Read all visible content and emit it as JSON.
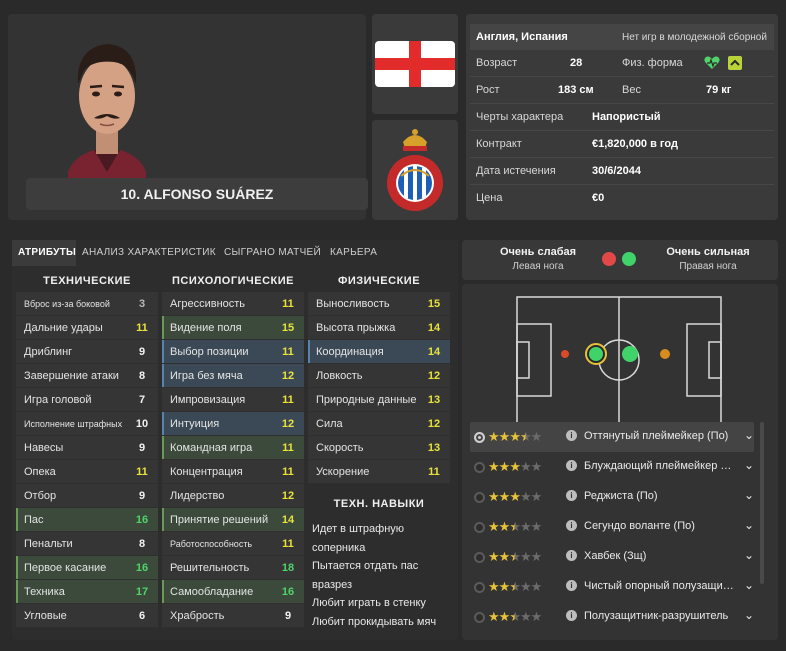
{
  "player": {
    "name": "10. ALFONSO SUÁREZ"
  },
  "info": {
    "nationality": "Англия, Испания",
    "youth_caps": "Нет игр в молодежной сборной",
    "age_label": "Возраст",
    "age": "28",
    "fitness_label": "Физ. форма",
    "height_label": "Рост",
    "height": "183 см",
    "weight_label": "Вес",
    "weight": "79 кг",
    "personality_label": "Черты характера",
    "personality": "Напористый",
    "contract_label": "Контракт",
    "contract": "€1,820,000 в год",
    "expiry_label": "Дата истечения",
    "expiry": "30/6/2044",
    "value_label": "Цена",
    "value": "€0"
  },
  "tabs": [
    "АТРИБУТЫ",
    "АНАЛИЗ ХАРАКТЕРИСТИК",
    "СЫГРАНО МАТЧЕЙ",
    "КАРЬЕРА"
  ],
  "columns": {
    "technical": "ТЕХНИЧЕСКИЕ",
    "mental": "ПСИХОЛОГИЧЕСКИЕ",
    "physical": "ФИЗИЧЕСКИЕ",
    "traits": "ТЕХН. НАВЫКИ"
  },
  "technical": [
    {
      "name": "Вброс из-за боковой",
      "value": "3"
    },
    {
      "name": "Дальние удары",
      "value": "11"
    },
    {
      "name": "Дриблинг",
      "value": "9"
    },
    {
      "name": "Завершение атаки",
      "value": "8"
    },
    {
      "name": "Игра головой",
      "value": "7"
    },
    {
      "name": "Исполнение штрафных",
      "value": "10"
    },
    {
      "name": "Навесы",
      "value": "9"
    },
    {
      "name": "Опека",
      "value": "11"
    },
    {
      "name": "Отбор",
      "value": "9"
    },
    {
      "name": "Пас",
      "value": "16"
    },
    {
      "name": "Пенальти",
      "value": "8"
    },
    {
      "name": "Первое касание",
      "value": "16"
    },
    {
      "name": "Техника",
      "value": "17"
    },
    {
      "name": "Угловые",
      "value": "6"
    }
  ],
  "mental": [
    {
      "name": "Агрессивность",
      "value": "11"
    },
    {
      "name": "Видение поля",
      "value": "15"
    },
    {
      "name": "Выбор позиции",
      "value": "11"
    },
    {
      "name": "Игра без мяча",
      "value": "12"
    },
    {
      "name": "Импровизация",
      "value": "11"
    },
    {
      "name": "Интуиция",
      "value": "12"
    },
    {
      "name": "Командная игра",
      "value": "11"
    },
    {
      "name": "Концентрация",
      "value": "11"
    },
    {
      "name": "Лидерство",
      "value": "12"
    },
    {
      "name": "Принятие решений",
      "value": "14"
    },
    {
      "name": "Работоспособность",
      "value": "11"
    },
    {
      "name": "Решительность",
      "value": "18"
    },
    {
      "name": "Самообладание",
      "value": "16"
    },
    {
      "name": "Храбрость",
      "value": "9"
    }
  ],
  "physical": [
    {
      "name": "Выносливость",
      "value": "15"
    },
    {
      "name": "Высота прыжка",
      "value": "14"
    },
    {
      "name": "Координация",
      "value": "14"
    },
    {
      "name": "Ловкость",
      "value": "12"
    },
    {
      "name": "Природные данные",
      "value": "13"
    },
    {
      "name": "Сила",
      "value": "12"
    },
    {
      "name": "Скорость",
      "value": "13"
    },
    {
      "name": "Ускорение",
      "value": "11"
    }
  ],
  "traits": [
    "Идет в штрафную соперника",
    "Пытается отдать пас вразрез",
    "Любит играть в стенку",
    "Любит прокидывать мяч"
  ],
  "feet": {
    "left_rating": "Очень слабая",
    "left_label": "Левая нога",
    "right_rating": "Очень сильная",
    "right_label": "Правая нога"
  },
  "roles": [
    {
      "name": "Оттянутый плеймейкер (По)",
      "stars": 3.5
    },
    {
      "name": "Блуждающий плеймейкер (По)",
      "stars": 3
    },
    {
      "name": "Реджиста (По)",
      "stars": 3
    },
    {
      "name": "Сегундо воланте (По)",
      "stars": 2.5
    },
    {
      "name": "Хавбек (Зщ)",
      "stars": 2.5
    },
    {
      "name": "Чистый опорный полузащитник",
      "stars": 2.5
    },
    {
      "name": "Полузащитник-разрушитель",
      "stars": 2.5
    }
  ],
  "colors": {
    "yellow": "#e8e23a",
    "green": "#4fd36a",
    "accent_green_row": "#3b4a3b",
    "accent_blue_row": "#3b4957"
  }
}
